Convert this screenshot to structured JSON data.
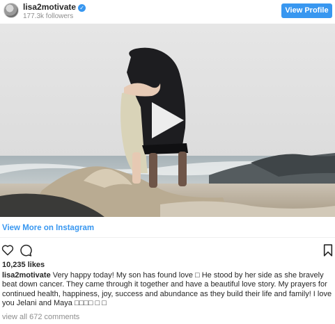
{
  "header": {
    "username": "lisa2motivate",
    "verified_icon": "verified-badge-icon",
    "followers": "177.3k followers",
    "view_profile_label": "View Profile"
  },
  "media": {
    "type": "video",
    "play_icon": "play-icon"
  },
  "view_more_label": "View More on Instagram",
  "actions": {
    "like_icon": "heart-icon",
    "comment_icon": "comment-bubble-icon",
    "save_icon": "bookmark-icon"
  },
  "likes": "10,235 likes",
  "caption": {
    "username": "lisa2motivate",
    "text": "Very happy today! My son has found love □ He stood by her side as she bravely beat down cancer. They came through it together and have a beautiful love story. My prayers for continued health, happiness, joy, success and abundance as they build their life and family! I love you Jelani and Maya □□□□ □ □"
  },
  "comments_link": "view all 672 comments",
  "colors": {
    "accent": "#3897f0",
    "text": "#262626",
    "muted": "#8e8e8e"
  }
}
